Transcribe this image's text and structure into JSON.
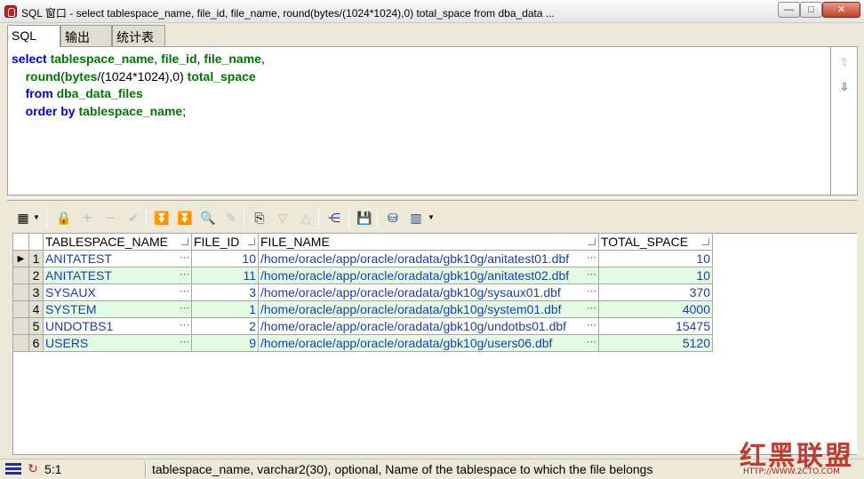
{
  "window": {
    "title": "SQL 窗口 - select tablespace_name, file_id, file_name, round(bytes/(1024*1024),0) total_space from dba_data ...",
    "min_label": "—",
    "max_label": "□",
    "close_label": "✕"
  },
  "tabs": [
    {
      "label": "SQL"
    },
    {
      "label": "输出"
    },
    {
      "label": "统计表"
    }
  ],
  "sql": {
    "line1": {
      "kw": "select",
      "c1": "tablespace_name",
      "c2": "file_id",
      "c3": "file_name"
    },
    "line2": {
      "fn": "round",
      "arg": "bytes",
      "expr": "(1024*1024),0",
      "alias": "total_space"
    },
    "line3": {
      "kw": "from",
      "tbl": "dba_data_files"
    },
    "line4": {
      "kw": "order by",
      "col": "tablespace_name"
    }
  },
  "grid": {
    "columns": [
      "TABLESPACE_NAME",
      "FILE_ID",
      "FILE_NAME",
      "TOTAL_SPACE"
    ],
    "rows": [
      {
        "num": "1",
        "tablespace_name": "ANITATEST",
        "file_id": "10",
        "file_name": "/home/oracle/app/oracle/oradata/gbk10g/anitatest01.dbf",
        "total_space": "10"
      },
      {
        "num": "2",
        "tablespace_name": "ANITATEST",
        "file_id": "11",
        "file_name": "/home/oracle/app/oracle/oradata/gbk10g/anitatest02.dbf",
        "total_space": "10"
      },
      {
        "num": "3",
        "tablespace_name": "SYSAUX",
        "file_id": "3",
        "file_name": "/home/oracle/app/oracle/oradata/gbk10g/sysaux01.dbf",
        "total_space": "370"
      },
      {
        "num": "4",
        "tablespace_name": "SYSTEM",
        "file_id": "1",
        "file_name": "/home/oracle/app/oracle/oradata/gbk10g/system01.dbf",
        "total_space": "4000"
      },
      {
        "num": "5",
        "tablespace_name": "UNDOTBS1",
        "file_id": "2",
        "file_name": "/home/oracle/app/oracle/oradata/gbk10g/undotbs01.dbf",
        "total_space": "15475"
      },
      {
        "num": "6",
        "tablespace_name": "USERS",
        "file_id": "9",
        "file_name": "/home/oracle/app/oracle/oradata/gbk10g/users06.dbf",
        "total_space": "5120"
      }
    ]
  },
  "statusbar": {
    "position": "5:1",
    "message": "tablespace_name, varchar2(30), optional, Name of the tablespace to which the file belongs"
  },
  "watermark": {
    "text_cn": "红黑联盟",
    "url": "HTTP://WWW.2CTO.COM"
  },
  "colors": {
    "keyword": "#0000cc",
    "identifier": "#007700",
    "grid_alt_row": "#e3fbe3",
    "grid_text": "#1c3fa8"
  }
}
